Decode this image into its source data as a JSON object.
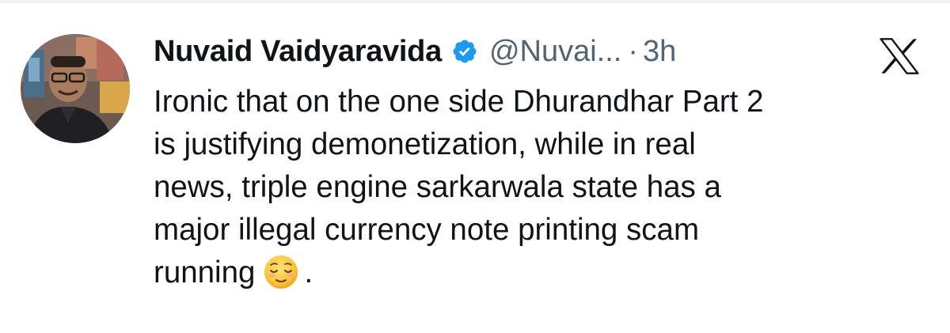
{
  "tweet": {
    "author_name": "Nuvaid Vaidyaravida",
    "handle": "@Nuvai...",
    "separator": "·",
    "time": "3h",
    "verified": true,
    "text_lines": [
      "Ironic that on the one side Dhurandhar Part 2",
      "is justifying demonetization, while in real",
      "news, triple engine sarkarwala state has a",
      "major illegal currency note printing scam"
    ],
    "last_line_text": "running",
    "last_line_suffix": ".",
    "emoji_name": "relieved-face-emoji"
  },
  "icons": {
    "verified": "verified-badge-icon",
    "platform_logo": "x-logo-icon"
  },
  "colors": {
    "primary_text": "#0f1419",
    "secondary_text": "#536471",
    "verified_blue": "#1d9bf0",
    "background": "#ffffff"
  }
}
